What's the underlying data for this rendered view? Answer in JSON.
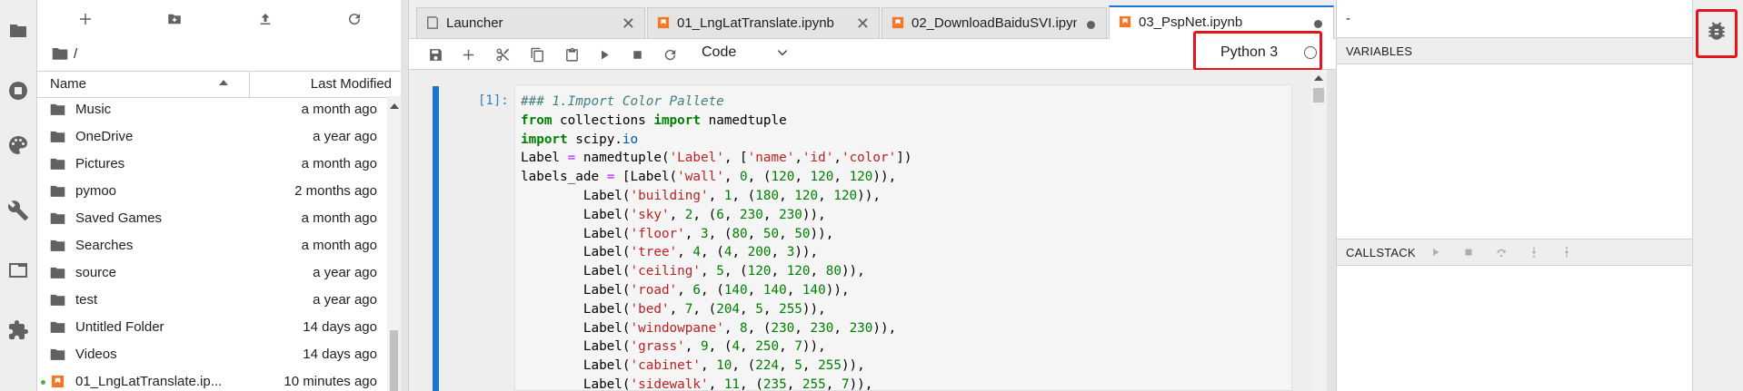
{
  "file_browser": {
    "breadcrumb": "/",
    "header_name": "Name",
    "header_modified": "Last Modified",
    "files": [
      {
        "name": "Music",
        "modified": "a month ago",
        "kind": "folder",
        "running": false
      },
      {
        "name": "OneDrive",
        "modified": "a year ago",
        "kind": "folder",
        "running": false
      },
      {
        "name": "Pictures",
        "modified": "a month ago",
        "kind": "folder",
        "running": false
      },
      {
        "name": "pymoo",
        "modified": "2 months ago",
        "kind": "folder",
        "running": false
      },
      {
        "name": "Saved Games",
        "modified": "a month ago",
        "kind": "folder",
        "running": false
      },
      {
        "name": "Searches",
        "modified": "a month ago",
        "kind": "folder",
        "running": false
      },
      {
        "name": "source",
        "modified": "a year ago",
        "kind": "folder",
        "running": false
      },
      {
        "name": "test",
        "modified": "a year ago",
        "kind": "folder",
        "running": false
      },
      {
        "name": "Untitled Folder",
        "modified": "14 days ago",
        "kind": "folder",
        "running": false
      },
      {
        "name": "Videos",
        "modified": "14 days ago",
        "kind": "folder",
        "running": false
      },
      {
        "name": "01_LngLatTranslate.ip...",
        "modified": "10 minutes ago",
        "kind": "notebook",
        "running": true
      }
    ]
  },
  "tabs": [
    {
      "label": "Launcher",
      "icon": "launcher-icon",
      "state": "close",
      "active": false
    },
    {
      "label": "01_LngLatTranslate.ipynb",
      "icon": "notebook-icon",
      "state": "close",
      "active": false
    },
    {
      "label": "02_DownloadBaiduSVI.ipynb",
      "icon": "notebook-icon",
      "state": "dirty",
      "active": false
    },
    {
      "label": "03_PspNet.ipynb",
      "icon": "notebook-icon",
      "state": "dirty",
      "active": true
    }
  ],
  "toolbar": {
    "cell_type": "Code",
    "kernel_name": "Python 3"
  },
  "cell": {
    "prompt": "[1]:",
    "code_lines": [
      "### 1.Import Color Pallete",
      "from collections import namedtuple",
      "import scipy.io",
      "Label = namedtuple('Label', ['name','id','color'])",
      "labels_ade = [Label('wall', 0, (120, 120, 120)),",
      "        Label('building', 1, (180, 120, 120)),",
      "        Label('sky', 2, (6, 230, 230)),",
      "        Label('floor', 3, (80, 50, 50)),",
      "        Label('tree', 4, (4, 200, 3)),",
      "        Label('ceiling', 5, (120, 120, 80)),",
      "        Label('road', 6, (140, 140, 140)),",
      "        Label('bed', 7, (204, 5, 255)),",
      "        Label('windowpane', 8, (230, 230, 230)),",
      "        Label('grass', 9, (4, 250, 7)),",
      "        Label('cabinet', 10, (224, 5, 255)),",
      "        Label('sidewalk', 11, (235, 255, 7)),"
    ]
  },
  "debugger": {
    "title": "-",
    "variables_label": "VARIABLES",
    "callstack_label": "CALLSTACK"
  },
  "colors": {
    "accent": "#1976d2",
    "highlight_box": "#e8141c",
    "notebook_icon": "#f37726"
  }
}
